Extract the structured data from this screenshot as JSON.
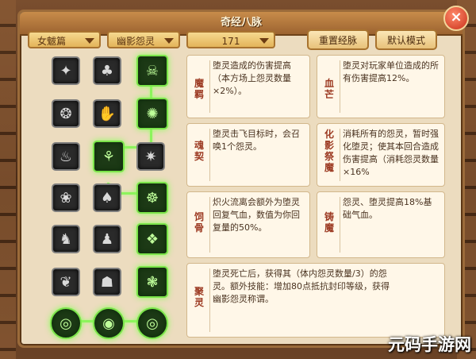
{
  "window": {
    "title": "奇经八脉"
  },
  "filters": {
    "sect": "女魃篇",
    "branch": "幽影怨灵",
    "points": "171"
  },
  "buttons": {
    "reset": "重置经脉",
    "default": "默认模式"
  },
  "skills": [
    {
      "name": "魔羁",
      "desc": "堕灵造成的伤害提高（本方场上怨灵数量×2%）。"
    },
    {
      "name": "血芒",
      "desc": "堕灵对玩家单位造成的所有伤害提高12%。"
    },
    {
      "name": "魂契",
      "desc": "堕灵击飞目标时，会召唤1个怨灵。"
    },
    {
      "name": "化影祭魔",
      "desc": "消耗所有的怨灵，暂时强化堕灵；使其本回合造成伤害提高（消耗怨灵数量×16%"
    },
    {
      "name": "饲骨",
      "desc": "炽火流离会额外为堕灵回复气血，数值为你回复量的50%。"
    },
    {
      "name": "铸魔",
      "desc": "怨灵、堕灵提高18%基础气血。"
    },
    {
      "name": "聚灵",
      "desc": "堕灵死亡后，获得其（体内怨灵数量/3）的怨灵。额外技能：增加80点抵抗封印等级，获得幽影怨灵称谓。"
    }
  ],
  "watermark": "元码手游网"
}
